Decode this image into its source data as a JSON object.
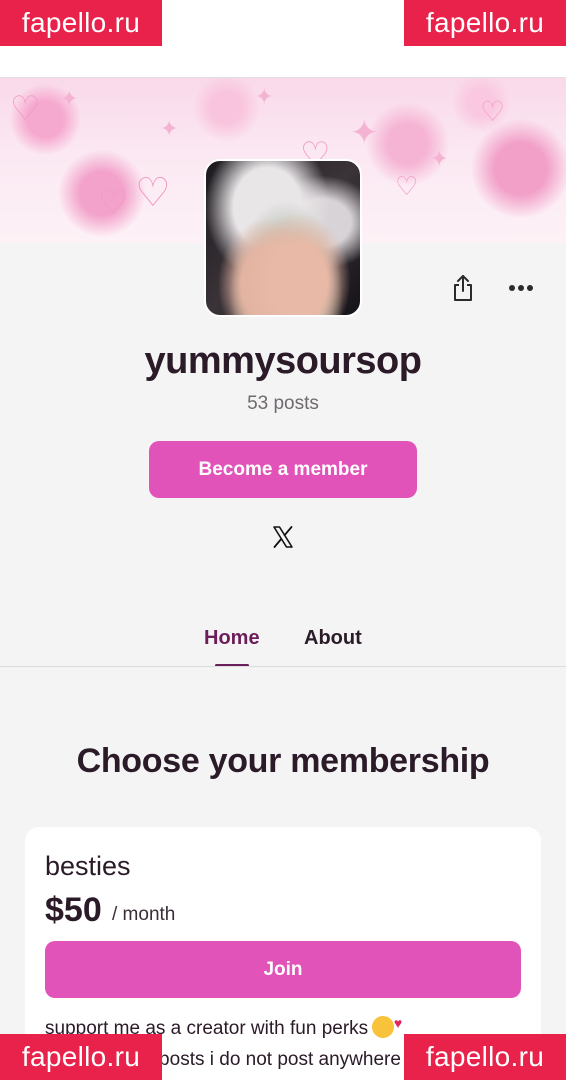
{
  "creator": {
    "name": "yummysoursop",
    "post_count": "53 posts"
  },
  "actions": {
    "become_member_label": "Become a member"
  },
  "tabs": [
    {
      "label": "Home",
      "active": true
    },
    {
      "label": "About",
      "active": false
    }
  ],
  "membership": {
    "section_title": "Choose your membership",
    "tiers": [
      {
        "name": "besties",
        "price": "$50",
        "period": "/ month",
        "join_label": "Join",
        "description_line1": "support me as a creator with fun perks",
        "description_line2": "random daily posts i do not post anywhere else"
      }
    ]
  },
  "watermark": {
    "text": "fapello.ru"
  },
  "colors": {
    "accent": "#e153b8",
    "active_tab": "#6b1f5a",
    "watermark_bg": "#e8224a"
  },
  "icons": [
    "share-icon",
    "more-options-icon",
    "x-social-icon"
  ]
}
